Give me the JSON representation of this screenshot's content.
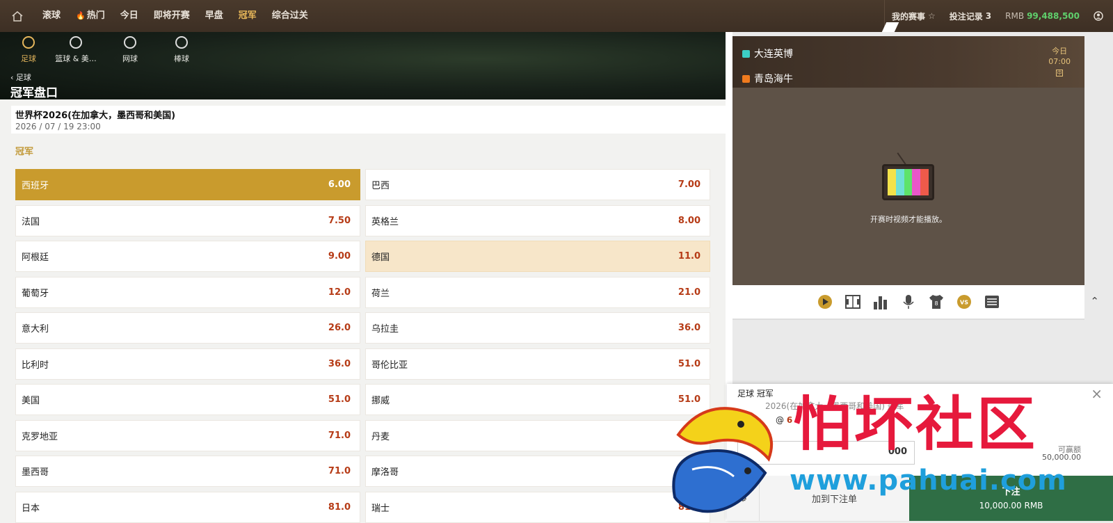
{
  "topbar": {
    "nav": [
      {
        "label": "滚球",
        "icon": null
      },
      {
        "label": "热门",
        "icon": "flame-icon"
      },
      {
        "label": "今日",
        "icon": null
      },
      {
        "label": "即将开赛",
        "icon": null
      },
      {
        "label": "早盘",
        "icon": null
      },
      {
        "label": "冠军",
        "icon": null,
        "active": true
      },
      {
        "label": "综合过关",
        "icon": null
      }
    ],
    "my_events": "我的赛事",
    "bet_records": "投注记录",
    "bet_count": "3",
    "currency": "RMB",
    "balance": "99,488,500"
  },
  "sports": [
    {
      "label": "足球",
      "icon": "soccer-ball-icon",
      "active": true
    },
    {
      "label": "篮球 & 美…",
      "icon": "basketball-icon",
      "active": false
    },
    {
      "label": "网球",
      "icon": "tennis-racket-icon",
      "active": false
    },
    {
      "label": "棒球",
      "icon": "baseball-icon",
      "active": false
    }
  ],
  "page": {
    "back_label": "足球",
    "title": "冠军盘口",
    "event_name": "世界杯2026(在加拿大，墨西哥和美国)",
    "event_date": "2026 / 07 / 19 23:00",
    "market": "冠军"
  },
  "outrights": [
    {
      "team": "西班牙",
      "odds": "6.00",
      "state": "selected"
    },
    {
      "team": "巴西",
      "odds": "7.00",
      "state": ""
    },
    {
      "team": "法国",
      "odds": "7.50",
      "state": ""
    },
    {
      "team": "英格兰",
      "odds": "8.00",
      "state": ""
    },
    {
      "team": "阿根廷",
      "odds": "9.00",
      "state": ""
    },
    {
      "team": "德国",
      "odds": "11.0",
      "state": "hover"
    },
    {
      "team": "葡萄牙",
      "odds": "12.0",
      "state": ""
    },
    {
      "team": "荷兰",
      "odds": "21.0",
      "state": ""
    },
    {
      "team": "意大利",
      "odds": "26.0",
      "state": ""
    },
    {
      "team": "乌拉圭",
      "odds": "36.0",
      "state": ""
    },
    {
      "team": "比利时",
      "odds": "36.0",
      "state": ""
    },
    {
      "team": "哥伦比亚",
      "odds": "51.0",
      "state": ""
    },
    {
      "team": "美国",
      "odds": "51.0",
      "state": ""
    },
    {
      "team": "挪威",
      "odds": "51.0",
      "state": ""
    },
    {
      "team": "克罗地亚",
      "odds": "71.0",
      "state": ""
    },
    {
      "team": "丹麦",
      "odds": "",
      "state": ""
    },
    {
      "team": "墨西哥",
      "odds": "71.0",
      "state": ""
    },
    {
      "team": "摩洛哥",
      "odds": "",
      "state": ""
    },
    {
      "team": "日本",
      "odds": "81.0",
      "state": ""
    },
    {
      "team": "瑞士",
      "odds": "81.0",
      "state": ""
    }
  ],
  "match": {
    "home": "大连英博",
    "away": "青岛海牛",
    "home_color": "#3ccfc6",
    "away_color": "#f07b1e",
    "day": "今日",
    "time": "07:00",
    "badge": "中",
    "video_msg": "开赛时视频才能播放。"
  },
  "tools": [
    "play-icon",
    "pitch-icon",
    "stats-bars-icon",
    "microphone-icon",
    "jersey-icon",
    "versus-icon",
    "scoreboard-icon"
  ],
  "tool_labels": {
    "jersey": "8",
    "vs": "VS"
  },
  "slip": {
    "title": "足球 冠军",
    "event": "2026(在加拿大，墨西哥和美国) 冠军",
    "at": "@",
    "odds": "6",
    "stake": "000",
    "win_label": "可赢额",
    "win_value": "50,000.00",
    "add_label": "加到下注单",
    "bet_label": "下注",
    "bet_amount": "10,000.00 RMB"
  },
  "watermark": {
    "text": "怕坏社区",
    "url": "www.pahuai.com"
  }
}
